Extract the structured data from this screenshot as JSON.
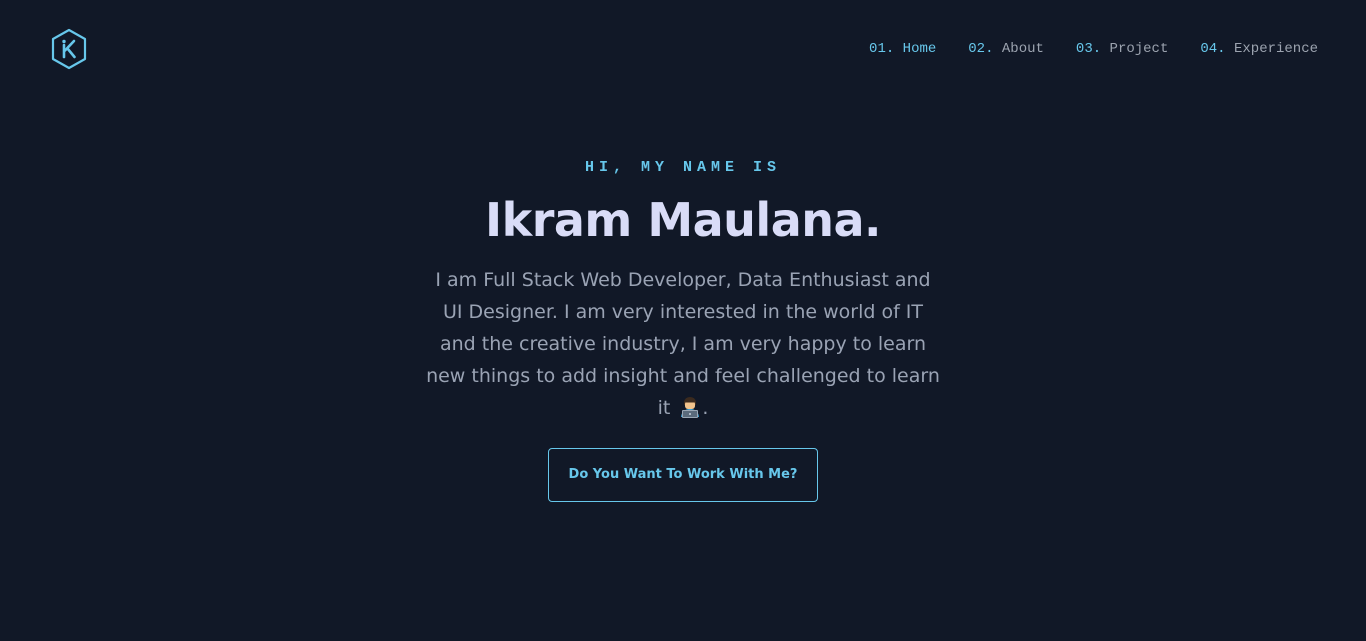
{
  "logo": {
    "icon": "hexagon-k-logo-icon",
    "letter": "K"
  },
  "nav": {
    "items": [
      {
        "num": "01.",
        "label": "Home",
        "active": true
      },
      {
        "num": "02.",
        "label": "About"
      },
      {
        "num": "03.",
        "label": "Project"
      },
      {
        "num": "04.",
        "label": "Experience"
      }
    ]
  },
  "hero": {
    "eyebrow": "HI, MY NAME IS",
    "name": "Ikram Maulana.",
    "bio": "I am Full Stack Web Developer, Data Enthusiast and UI Designer. I am very interested in the world of IT and the creative industry, I am very happy to learn new things to add insight and feel challenged to learn it",
    "bio_emoji_icon": "technologist-emoji-icon",
    "bio_end": ".",
    "cta_label": "Do You Want To Work With Me?"
  },
  "colors": {
    "background": "#111827",
    "accent": "#67c7eb",
    "heading": "#d9dcf7",
    "body_text": "#9aa3b4",
    "nav_text": "#9ca3af"
  }
}
